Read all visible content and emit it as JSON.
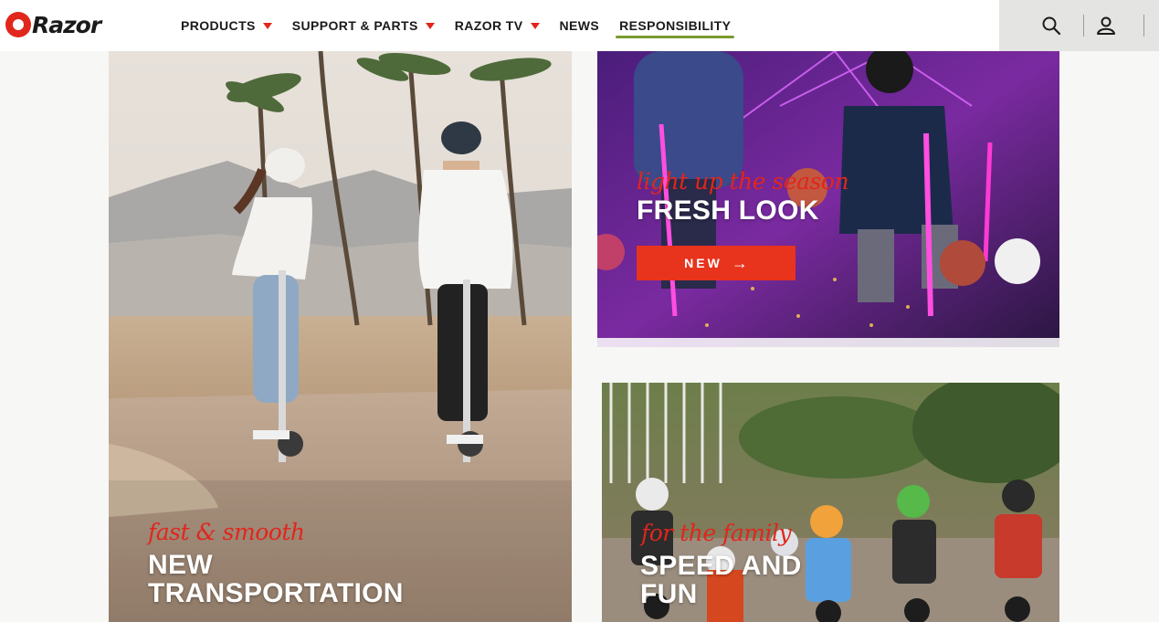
{
  "brand": {
    "name": "Razor",
    "accent": "#e1261c",
    "nav_underline": "#7a9b2e"
  },
  "nav": {
    "items": [
      {
        "label": "PRODUCTS",
        "dropdown": true
      },
      {
        "label": "SUPPORT & PARTS",
        "dropdown": true
      },
      {
        "label": "RAZOR TV",
        "dropdown": true
      },
      {
        "label": "NEWS",
        "dropdown": false
      },
      {
        "label": "RESPONSIBILITY",
        "dropdown": false,
        "active": true
      }
    ]
  },
  "header_tools": {
    "search_icon": "search-icon",
    "account_icon": "user-icon"
  },
  "tiles": {
    "transportation": {
      "tag": "fast & smooth",
      "headline_1": "NEW",
      "headline_2": "TRANSPORTATION"
    },
    "fresh_look": {
      "tag": "light up the season",
      "headline": "FRESH LOOK",
      "cta": "NEW",
      "cta_icon": "arrow-right-icon"
    },
    "speed_fun": {
      "tag": "for the family",
      "headline_1": "SPEED AND",
      "headline_2": "FUN"
    }
  }
}
